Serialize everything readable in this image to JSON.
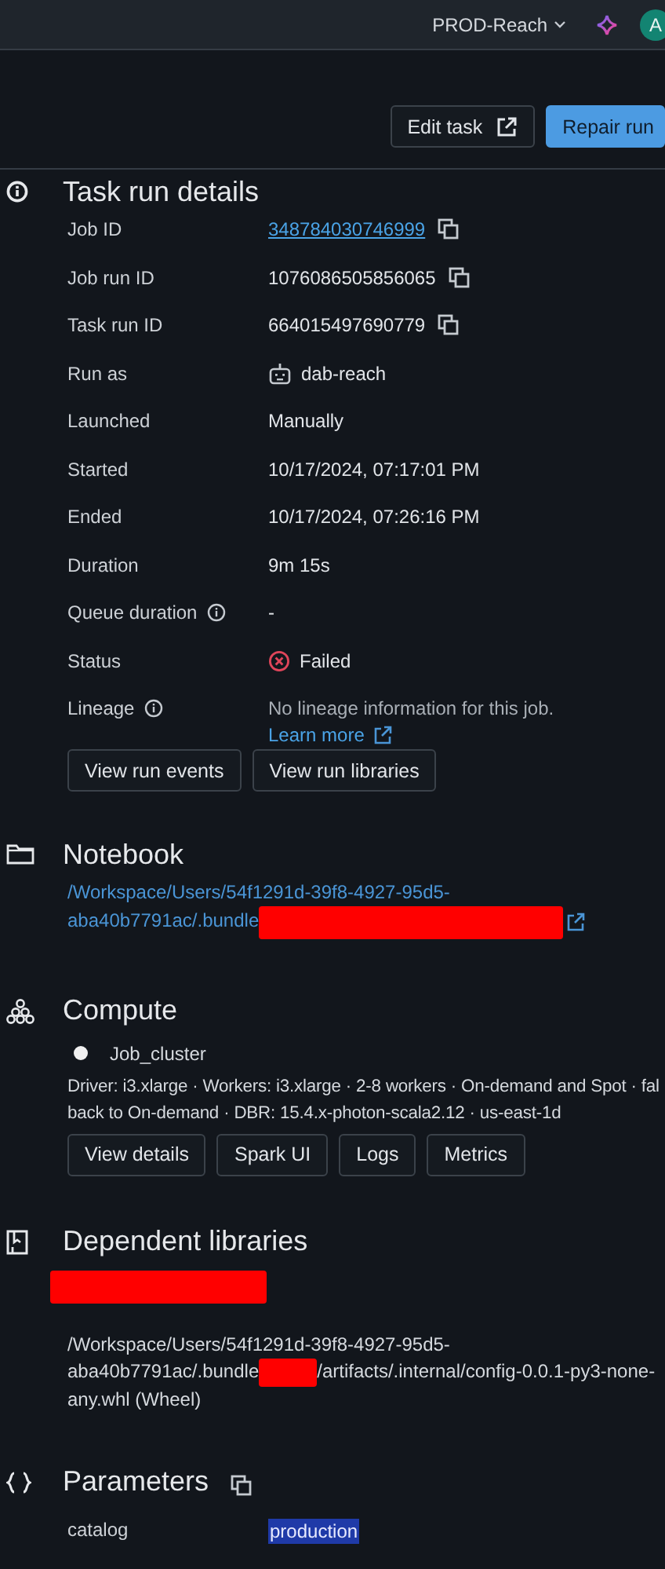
{
  "topbar": {
    "workspace": "PROD-Reach",
    "avatar": "A"
  },
  "actions": [
    {
      "label": "Edit task",
      "kind": "secondary"
    },
    {
      "label": "Repair run",
      "kind": "primary"
    }
  ],
  "details": {
    "title": "Task run details",
    "rows": [
      {
        "label": "Job ID",
        "info": false,
        "kind": "link",
        "value": "348784030746999",
        "copyable": true
      },
      {
        "label": "Job run ID",
        "info": false,
        "kind": "text",
        "value": "1076086505856065",
        "copyable": true
      },
      {
        "label": "Task run ID",
        "info": false,
        "kind": "text",
        "value": "664015497690779",
        "copyable": true
      },
      {
        "label": "Run as",
        "info": false,
        "kind": "user",
        "value": "dab-reach",
        "copyable": false
      },
      {
        "label": "Launched",
        "info": false,
        "kind": "text",
        "value": "Manually",
        "copyable": false
      },
      {
        "label": "Started",
        "info": false,
        "kind": "text",
        "value": "10/17/2024, 07:17:01 PM",
        "copyable": false
      },
      {
        "label": "Ended",
        "info": false,
        "kind": "text",
        "value": "10/17/2024, 07:26:16 PM",
        "copyable": false
      },
      {
        "label": "Duration",
        "info": false,
        "kind": "text",
        "value": "9m 15s",
        "copyable": false
      },
      {
        "label": "Queue duration",
        "info": true,
        "kind": "text",
        "value": "-",
        "copyable": false
      },
      {
        "label": "Status",
        "info": false,
        "kind": "failed",
        "value": "Failed",
        "copyable": false
      },
      {
        "label": "Lineage",
        "info": true,
        "kind": "note",
        "value": "No lineage information for this job.",
        "link": "Learn more",
        "copyable": false
      }
    ],
    "buttons": [
      "View run events",
      "View run libraries"
    ]
  },
  "notebook": {
    "title": "Notebook",
    "path_lines": [
      [
        {
          "kind": "text",
          "text": "/Workspace/Users/54f1291d-39f8-4927-95d5-"
        }
      ],
      [
        {
          "kind": "text",
          "text": "aba40b7791ac/.bundle"
        },
        {
          "kind": "redacted"
        }
      ]
    ]
  },
  "compute": {
    "title": "Compute",
    "cluster": "Job_cluster",
    "spec_lines": [
      "Driver: i3.xlarge · Workers: i3.xlarge · 2-8 workers · On-demand and Spot · fal",
      "back to On-demand · DBR: 15.4.x-photon-scala2.12 · us-east-1d"
    ],
    "buttons": [
      "View details",
      "Spark UI",
      "Logs",
      "Metrics"
    ]
  },
  "libraries": {
    "title": "Dependent libraries",
    "items": [
      {
        "name_redacted": true,
        "path_lines": [
          [
            {
              "kind": "text",
              "text": "/Workspace/Users/54f1291d-39f8-4927-95d5-"
            }
          ],
          [
            {
              "kind": "text",
              "text": "aba40b7791ac/.bundle"
            },
            {
              "kind": "redacted"
            },
            {
              "kind": "text",
              "text": "/artifacts/.internal/config-0.0.1-py3-none-"
            }
          ],
          [
            {
              "kind": "text",
              "text": "any.whl (Wheel)"
            }
          ]
        ]
      }
    ]
  },
  "parameters": {
    "title": "Parameters",
    "rows": [
      {
        "name": "catalog",
        "value": "production",
        "highlighted": true
      }
    ]
  }
}
